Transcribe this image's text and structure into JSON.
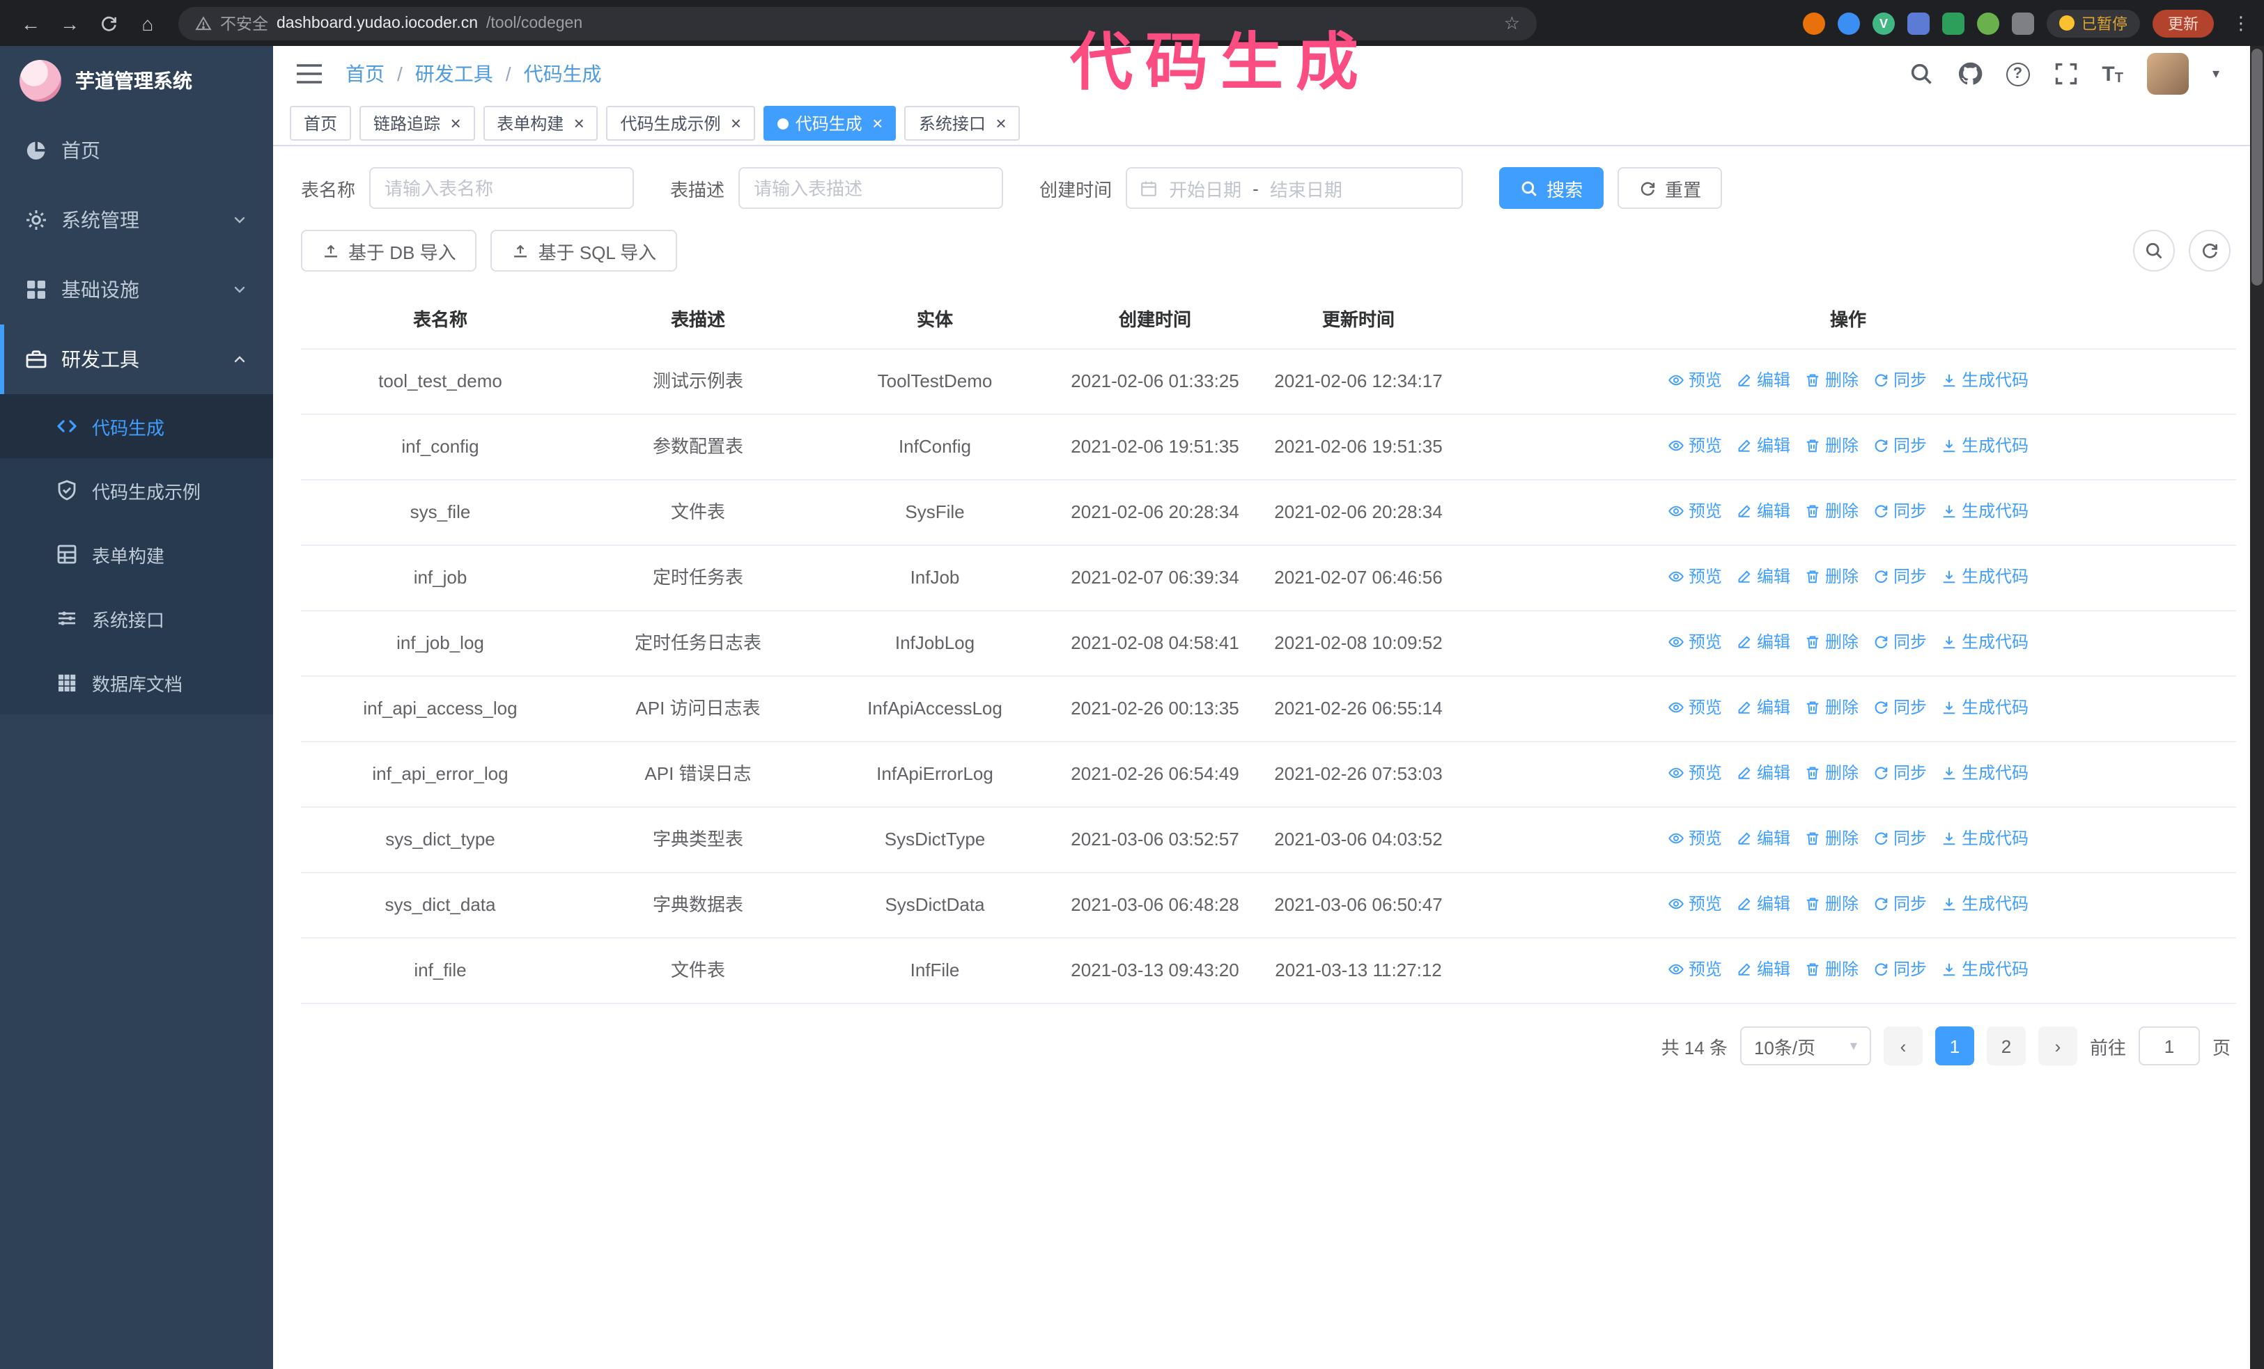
{
  "browser": {
    "security_label": "不安全",
    "url_host": "dashboard.yudao.iocoder.cn",
    "url_path": "/tool/codegen",
    "paused_label": "已暂停",
    "update_label": "更新"
  },
  "annotation": {
    "text": "代码生成",
    "color": "#fb4d82"
  },
  "sidebar": {
    "logo_title": "芋道管理系统",
    "items": [
      {
        "key": "home",
        "label": "首页",
        "icon": "dashboard-icon",
        "type": "item"
      },
      {
        "key": "system",
        "label": "系统管理",
        "icon": "gear-icon",
        "type": "group",
        "state": "collapsed"
      },
      {
        "key": "infra",
        "label": "基础设施",
        "icon": "infra-icon",
        "type": "group",
        "state": "collapsed"
      },
      {
        "key": "devtools",
        "label": "研发工具",
        "icon": "tools-icon",
        "type": "group",
        "state": "expanded",
        "children": [
          {
            "key": "codegen",
            "label": "代码生成",
            "icon": "code-icon",
            "active": true
          },
          {
            "key": "codegen-demo",
            "label": "代码生成示例",
            "icon": "example-icon",
            "active": false
          },
          {
            "key": "form-builder",
            "label": "表单构建",
            "icon": "form-icon",
            "active": false
          },
          {
            "key": "api",
            "label": "系统接口",
            "icon": "api-icon",
            "active": false
          },
          {
            "key": "db-doc",
            "label": "数据库文档",
            "icon": "db-doc-icon",
            "active": false
          }
        ]
      }
    ]
  },
  "header": {
    "breadcrumb": [
      "首页",
      "研发工具",
      "代码生成"
    ]
  },
  "tabs": [
    {
      "key": "home",
      "label": "首页",
      "closable": false,
      "active": false
    },
    {
      "key": "trace",
      "label": "链路追踪",
      "closable": true,
      "active": false
    },
    {
      "key": "form-builder",
      "label": "表单构建",
      "closable": true,
      "active": false
    },
    {
      "key": "codegen-demo",
      "label": "代码生成示例",
      "closable": true,
      "active": false
    },
    {
      "key": "codegen",
      "label": "代码生成",
      "closable": true,
      "active": true
    },
    {
      "key": "api",
      "label": "系统接口",
      "closable": true,
      "active": false
    }
  ],
  "filters": {
    "table_name_label": "表名称",
    "table_name_placeholder": "请输入表名称",
    "table_desc_label": "表描述",
    "table_desc_placeholder": "请输入表描述",
    "create_time_label": "创建时间",
    "start_placeholder": "开始日期",
    "range_separator": "-",
    "end_placeholder": "结束日期",
    "search_label": "搜索",
    "reset_label": "重置"
  },
  "toolbar": {
    "import_db_label": "基于 DB 导入",
    "import_sql_label": "基于 SQL 导入"
  },
  "table": {
    "columns": [
      "表名称",
      "表描述",
      "实体",
      "创建时间",
      "更新时间",
      "操作"
    ],
    "actions": [
      {
        "key": "preview",
        "label": "预览",
        "icon": "eye-icon"
      },
      {
        "key": "edit",
        "label": "编辑",
        "icon": "edit-icon"
      },
      {
        "key": "delete",
        "label": "删除",
        "icon": "delete-icon"
      },
      {
        "key": "sync",
        "label": "同步",
        "icon": "sync-icon"
      },
      {
        "key": "generate",
        "label": "生成代码",
        "icon": "download-icon"
      }
    ],
    "rows": [
      {
        "name": "tool_test_demo",
        "desc": "测试示例表",
        "entity": "ToolTestDemo",
        "created": "2021-02-06 01:33:25",
        "updated": "2021-02-06 12:34:17"
      },
      {
        "name": "inf_config",
        "desc": "参数配置表",
        "entity": "InfConfig",
        "created": "2021-02-06 19:51:35",
        "updated": "2021-02-06 19:51:35"
      },
      {
        "name": "sys_file",
        "desc": "文件表",
        "entity": "SysFile",
        "created": "2021-02-06 20:28:34",
        "updated": "2021-02-06 20:28:34"
      },
      {
        "name": "inf_job",
        "desc": "定时任务表",
        "entity": "InfJob",
        "created": "2021-02-07 06:39:34",
        "updated": "2021-02-07 06:46:56"
      },
      {
        "name": "inf_job_log",
        "desc": "定时任务日志表",
        "entity": "InfJobLog",
        "created": "2021-02-08 04:58:41",
        "updated": "2021-02-08 10:09:52"
      },
      {
        "name": "inf_api_access_log",
        "desc": "API 访问日志表",
        "entity": "InfApiAccessLog",
        "created": "2021-02-26 00:13:35",
        "updated": "2021-02-26 06:55:14"
      },
      {
        "name": "inf_api_error_log",
        "desc": "API 错误日志",
        "entity": "InfApiErrorLog",
        "created": "2021-02-26 06:54:49",
        "updated": "2021-02-26 07:53:03"
      },
      {
        "name": "sys_dict_type",
        "desc": "字典类型表",
        "entity": "SysDictType",
        "created": "2021-03-06 03:52:57",
        "updated": "2021-03-06 04:03:52"
      },
      {
        "name": "sys_dict_data",
        "desc": "字典数据表",
        "entity": "SysDictData",
        "created": "2021-03-06 06:48:28",
        "updated": "2021-03-06 06:50:47"
      },
      {
        "name": "inf_file",
        "desc": "文件表",
        "entity": "InfFile",
        "created": "2021-03-13 09:43:20",
        "updated": "2021-03-13 11:27:12"
      }
    ]
  },
  "pagination": {
    "total_label": "共 14 条",
    "page_size_label": "10条/页",
    "pages": [
      "1",
      "2"
    ],
    "active_page": "1",
    "goto_label": "前往",
    "goto_value": "1",
    "goto_suffix": "页"
  },
  "colors": {
    "accent": "#409eff",
    "sidebar_bg": "#2f4156",
    "annotation": "#fb4d82"
  }
}
